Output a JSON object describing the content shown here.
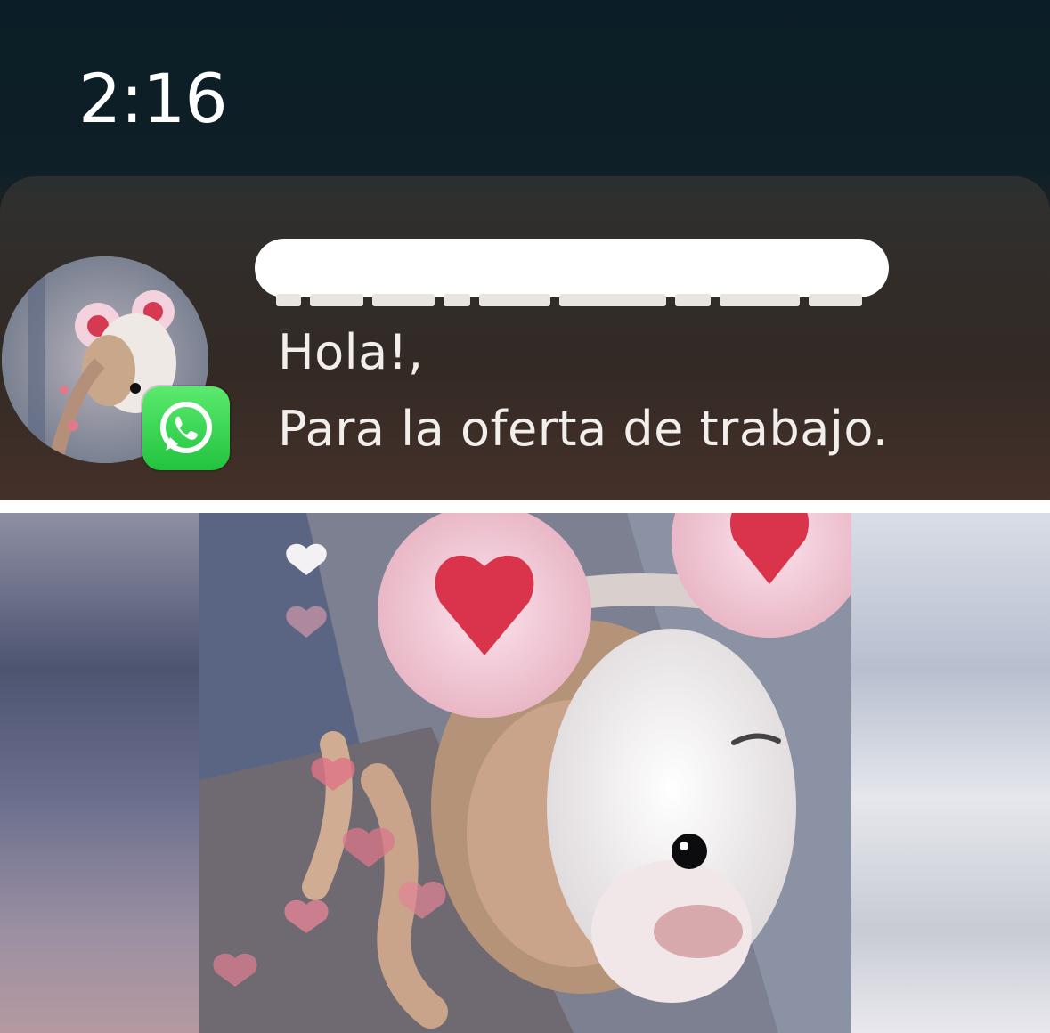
{
  "status_bar": {
    "time": "2:16"
  },
  "notification": {
    "app": "WhatsApp",
    "app_icon": "whatsapp-icon",
    "sender_redacted": true,
    "message_line_1": "Hola!,",
    "message_line_2": "Para la oferta de trabajo.",
    "badge_color": "#25d366"
  },
  "profile_photo": {
    "description_icon": "profile-photo",
    "accent_colors": {
      "heart": "#d9344c",
      "ear_fluff": "#f3c6d6",
      "dog_face": "#f4f2f2"
    }
  }
}
